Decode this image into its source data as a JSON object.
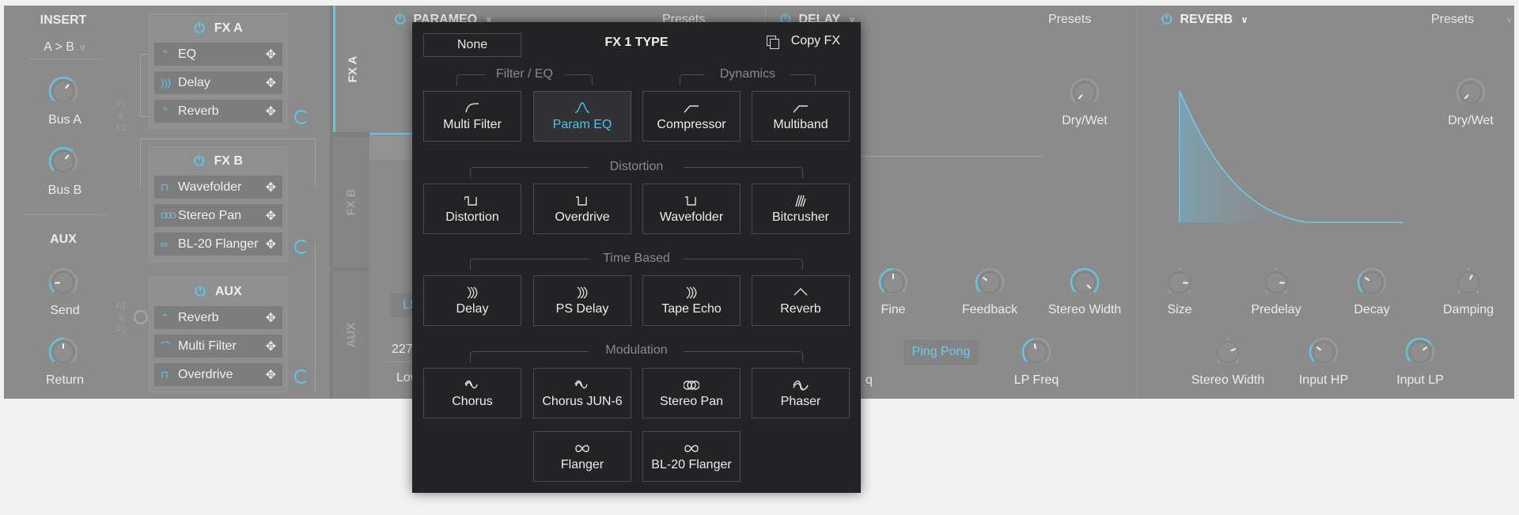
{
  "left": {
    "insert_title": "INSERT",
    "routing_value": "A > B",
    "knobs_insert": [
      {
        "label": "Bus A",
        "value": 0.65
      },
      {
        "label": "Bus B",
        "value": 0.65
      }
    ],
    "aux_title": "AUX",
    "knobs_aux": [
      {
        "label": "Send",
        "value": 0.15
      },
      {
        "label": "Return",
        "value": 0.5
      }
    ]
  },
  "chains": [
    {
      "title": "FX A",
      "slots": [
        {
          "icon": "param-eq-icon",
          "glyph": "⌃",
          "label": "EQ"
        },
        {
          "icon": "delay-icon",
          "glyph": ")))",
          "label": "Delay"
        },
        {
          "icon": "reverb-icon",
          "glyph": "⌃",
          "label": "Reverb"
        }
      ]
    },
    {
      "title": "FX B",
      "slots": [
        {
          "icon": "wavefolder-icon",
          "glyph": "⊓",
          "label": "Wavefolder"
        },
        {
          "icon": "stereo-pan-icon",
          "glyph": "OOO",
          "label": "Stereo Pan"
        },
        {
          "icon": "flanger-icon",
          "glyph": "∞",
          "label": "BL-20 Flanger"
        }
      ]
    },
    {
      "title": "AUX",
      "slots": [
        {
          "icon": "reverb-icon",
          "glyph": "⌃",
          "label": "Reverb"
        },
        {
          "icon": "multi-filter-icon",
          "glyph": "⌒",
          "label": "Multi Filter"
        },
        {
          "icon": "overdrive-icon",
          "glyph": "⊓",
          "label": "Overdrive"
        }
      ]
    }
  ],
  "routing_labels": {
    "f1": "F1",
    "amp": "&",
    "f2": "F2"
  },
  "tabs": [
    {
      "label": "FX A",
      "active": true
    },
    {
      "label": "FX B",
      "active": false
    },
    {
      "label": "AUX",
      "active": false
    }
  ],
  "panels": {
    "fx1": {
      "name": "PARAMEQ",
      "presets": "Presets",
      "ls_label": "LS",
      "value_text": "227",
      "low_text": "Low"
    },
    "fx2": {
      "name": "DELAY",
      "presets": "Presets",
      "dry_wet": {
        "label": "Dry/Wet",
        "value": 0.0
      },
      "knobs": [
        {
          "label": "Fine",
          "value": 0.5
        },
        {
          "label": "Feedback",
          "value": 0.3
        },
        {
          "label": "Stereo Width",
          "value": 1.0
        }
      ],
      "ping_pong": "Ping Pong",
      "lp_freq": {
        "label": "LP Freq",
        "value": 0.45
      },
      "freq_label_partial": "q"
    },
    "fx3": {
      "name": "REVERB",
      "presets": "Presets",
      "dry_wet": {
        "label": "Dry/Wet",
        "value": 0.0
      },
      "knobs_row1": [
        {
          "label": "Size",
          "value": 0.85
        },
        {
          "label": "Predelay",
          "value": 0.85
        },
        {
          "label": "Decay",
          "value": 0.3
        },
        {
          "label": "Damping",
          "value": 0.6
        }
      ],
      "knobs_row2": [
        {
          "label": "Stereo Width",
          "value": 0.75
        },
        {
          "label": "Input HP",
          "value": 0.3
        },
        {
          "label": "Input LP",
          "value": 0.7
        }
      ]
    }
  },
  "popup": {
    "none_label": "None",
    "title": "FX 1 TYPE",
    "copy_label": "Copy FX",
    "groups": [
      {
        "label": "Filter / EQ"
      },
      {
        "label": "Dynamics"
      },
      {
        "label": "Distortion"
      },
      {
        "label": "Time Based"
      },
      {
        "label": "Modulation"
      }
    ],
    "buttons": [
      {
        "label": "Multi Filter",
        "icon": "multi-filter-icon",
        "selected": false
      },
      {
        "label": "Param EQ",
        "icon": "param-eq-icon",
        "selected": true
      },
      {
        "label": "Compressor",
        "icon": "compressor-icon",
        "selected": false
      },
      {
        "label": "Multiband",
        "icon": "multiband-icon",
        "selected": false
      },
      {
        "label": "Distortion",
        "icon": "distortion-icon",
        "selected": false
      },
      {
        "label": "Overdrive",
        "icon": "overdrive-icon",
        "selected": false
      },
      {
        "label": "Wavefolder",
        "icon": "wavefolder-icon",
        "selected": false
      },
      {
        "label": "Bitcrusher",
        "icon": "bitcrusher-icon",
        "selected": false
      },
      {
        "label": "Delay",
        "icon": "delay-icon",
        "selected": false
      },
      {
        "label": "PS Delay",
        "icon": "delay-icon",
        "selected": false
      },
      {
        "label": "Tape Echo",
        "icon": "delay-icon",
        "selected": false
      },
      {
        "label": "Reverb",
        "icon": "reverb-icon",
        "selected": false
      },
      {
        "label": "Chorus",
        "icon": "chorus-icon",
        "selected": false
      },
      {
        "label": "Chorus JUN-6",
        "icon": "chorus-icon",
        "selected": false
      },
      {
        "label": "Stereo Pan",
        "icon": "stereo-pan-icon",
        "selected": false
      },
      {
        "label": "Phaser",
        "icon": "phaser-icon",
        "selected": false
      },
      {
        "label": "Flanger",
        "icon": "flanger-icon",
        "selected": false
      },
      {
        "label": "BL-20 Flanger",
        "icon": "flanger-icon",
        "selected": false
      }
    ]
  },
  "colors": {
    "accent": "#5ec7ec",
    "selected_text": "#4fc3f0",
    "popup_bg": "#232325",
    "panel_bg": "#8b8b8c"
  }
}
